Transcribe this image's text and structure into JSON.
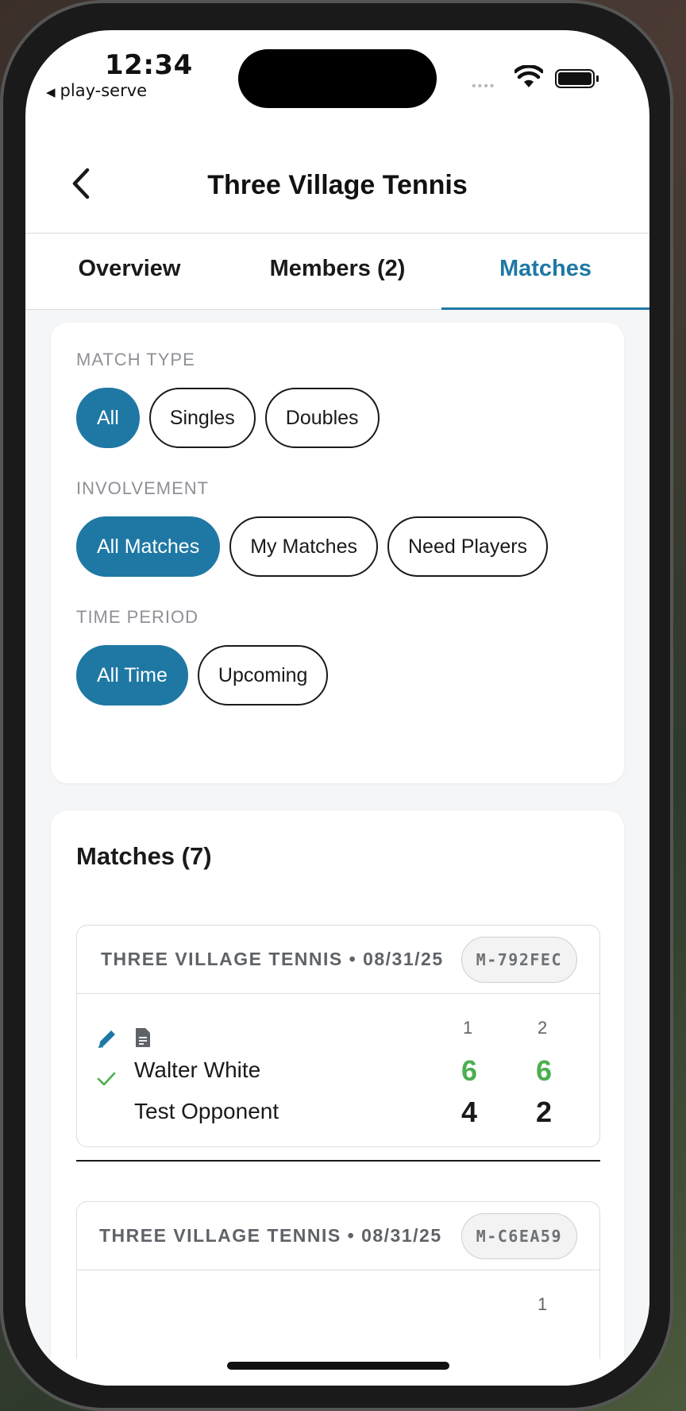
{
  "status_bar": {
    "time": "12:34",
    "back_app": "play-serve"
  },
  "header": {
    "title": "Three Village Tennis"
  },
  "tabs": [
    {
      "label": "Overview",
      "active": false
    },
    {
      "label": "Members (2)",
      "active": false
    },
    {
      "label": "Matches",
      "active": true
    }
  ],
  "filters": {
    "match_type": {
      "label": "MATCH TYPE",
      "options": [
        "All",
        "Singles",
        "Doubles"
      ],
      "selected": "All"
    },
    "involvement": {
      "label": "INVOLVEMENT",
      "options": [
        "All Matches",
        "My Matches",
        "Need Players"
      ],
      "selected": "All Matches"
    },
    "time_period": {
      "label": "TIME PERIOD",
      "options": [
        "All Time",
        "Upcoming"
      ],
      "selected": "All Time"
    }
  },
  "matches": {
    "title": "Matches (7)",
    "items": [
      {
        "header": "THREE VILLAGE TENNIS • 08/31/25",
        "id": "M-792FEC",
        "set_headers": [
          "1",
          "2"
        ],
        "players": [
          {
            "name": "Walter White",
            "winner": true,
            "scores": [
              "6",
              "6"
            ]
          },
          {
            "name": "Test Opponent",
            "winner": false,
            "scores": [
              "4",
              "2"
            ]
          }
        ]
      },
      {
        "header": "THREE VILLAGE TENNIS • 08/31/25",
        "id": "M-C6EA59",
        "set_headers": [
          "1"
        ]
      }
    ]
  },
  "colors": {
    "accent": "#1f78a4",
    "win_score": "#4caf50",
    "muted_text": "#8e9196"
  },
  "icons": [
    "back-chevron-icon",
    "wifi-icon",
    "battery-icon",
    "edit-pencil-icon",
    "document-icon",
    "check-icon"
  ]
}
